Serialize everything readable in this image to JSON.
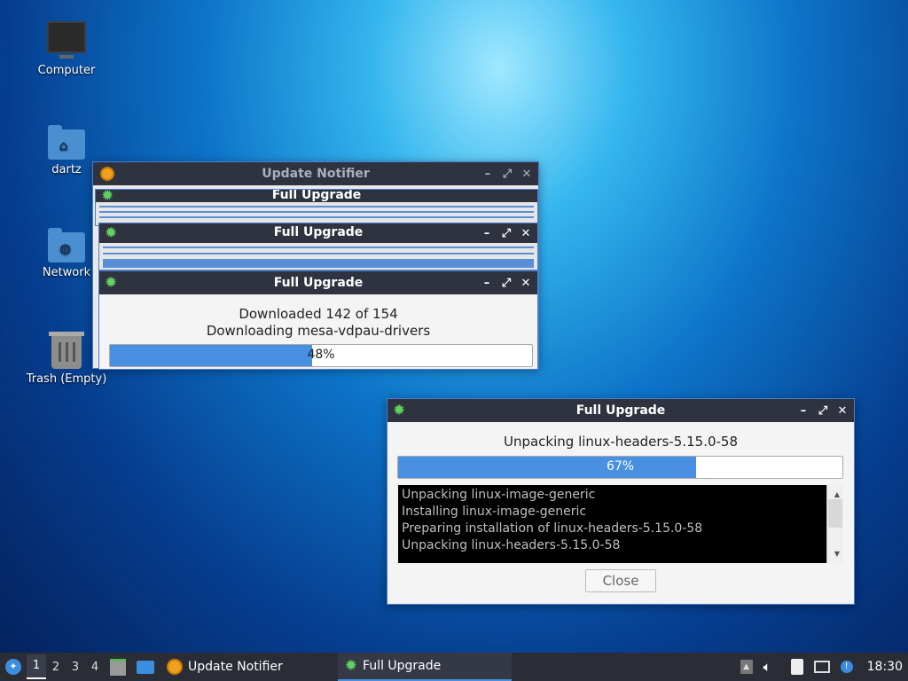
{
  "desktop": {
    "icons": [
      {
        "label": "Computer"
      },
      {
        "label": "dartz"
      },
      {
        "label": "Network"
      },
      {
        "label": "Trash (Empty)"
      }
    ]
  },
  "update_notifier": {
    "title": "Update Notifier",
    "stacked_title_1": "Full Upgrade",
    "stacked_title_2": "Full Upgrade"
  },
  "download_window": {
    "title": "Full Upgrade",
    "line1": "Downloaded 142 of 154",
    "line2": "Downloading mesa-vdpau-drivers",
    "progress_percent": 48,
    "progress_label": "48%"
  },
  "unpack_window": {
    "title": "Full Upgrade",
    "status": "Unpacking linux-headers-5.15.0-58",
    "progress_percent": 67,
    "progress_label": "67%",
    "log_lines": [
      "Unpacking linux-image-generic",
      "Installing linux-image-generic",
      "Preparing installation of linux-headers-5.15.0-58",
      "Unpacking linux-headers-5.15.0-58"
    ],
    "close_label": "Close"
  },
  "taskbar": {
    "workspaces": [
      "1",
      "2",
      "3",
      "4"
    ],
    "active_workspace": "1",
    "tasks": [
      {
        "label": "Update Notifier"
      },
      {
        "label": "Full Upgrade"
      }
    ],
    "clock": "18:30"
  },
  "colors": {
    "accent": "#4a90e2",
    "titlebar": "#2f3340",
    "taskbar": "#2a2d36"
  }
}
